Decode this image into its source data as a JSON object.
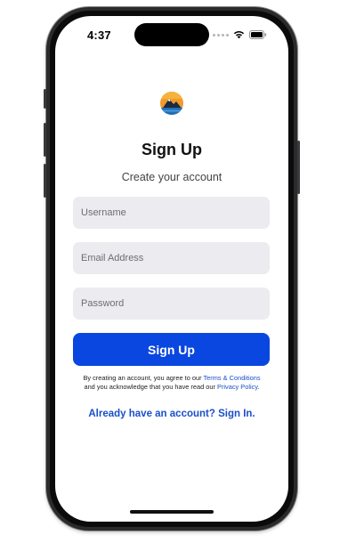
{
  "status_bar": {
    "time": "4:37"
  },
  "brand": {
    "logo_icon": "mountain-sunset-logo"
  },
  "header": {
    "title": "Sign Up",
    "subtitle": "Create your account"
  },
  "form": {
    "username_placeholder": "Username",
    "email_placeholder": "Email Address",
    "password_placeholder": "Password",
    "username_value": "",
    "email_value": "",
    "password_value": "",
    "submit_label": "Sign Up"
  },
  "legal": {
    "line1_prefix": "By creating an account, you agree to our ",
    "terms_link": "Terms & Conditions",
    "line2_prefix": "and you acknowledge that you have read our ",
    "privacy_link": "Privacy Policy",
    "line2_suffix": "."
  },
  "footer": {
    "signin_link": "Already have an account? Sign In."
  },
  "colors": {
    "primary": "#0a46e0",
    "link": "#1a4fc9",
    "field_bg": "#ebebf0"
  }
}
